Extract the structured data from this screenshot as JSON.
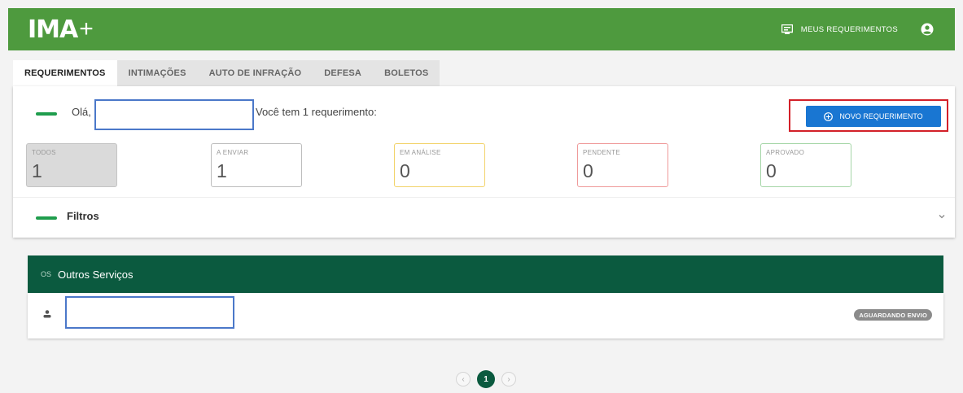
{
  "header": {
    "logo_text": "IMA",
    "logo_plus": "+",
    "meus_requerimentos": "MEUS REQUERIMENTOS",
    "color": "#4e9a3e"
  },
  "tabs": [
    {
      "label": "REQUERIMENTOS",
      "active": true
    },
    {
      "label": "INTIMAÇÕES",
      "active": false
    },
    {
      "label": "AUTO DE INFRAÇÃO",
      "active": false
    },
    {
      "label": "DEFESA",
      "active": false
    },
    {
      "label": "BOLETOS",
      "active": false
    }
  ],
  "card": {
    "greeting": "Olá,",
    "count_text": "Você tem 1 requerimento:",
    "novo_button": "NOVO REQUERIMENTO",
    "accent": "#1f9d4d"
  },
  "stats": [
    {
      "label": "TODOS",
      "value": "1",
      "color": "#dadada"
    },
    {
      "label": "A ENVIAR",
      "value": "1",
      "color": "#bdbdbd"
    },
    {
      "label": "EM ANÁLISE",
      "value": "0",
      "color": "#f2d36b"
    },
    {
      "label": "PENDENTE",
      "value": "0",
      "color": "#ef9a9a"
    },
    {
      "label": "APROVADO",
      "value": "0",
      "color": "#a5d6a7"
    }
  ],
  "filtros": "Filtros",
  "services": {
    "tag": "OS",
    "title": "Outros Serviços",
    "row_status": "AGUARDANDO ENVIO",
    "color": "#0b5a3f"
  },
  "pagination": {
    "current": "1",
    "prev": "‹",
    "next": "›"
  },
  "icons": {
    "meus_req": "document-list-icon",
    "user": "user-circle-icon",
    "add": "plus-circle-icon",
    "chevron": "chevron-down-icon",
    "person": "person-icon"
  }
}
